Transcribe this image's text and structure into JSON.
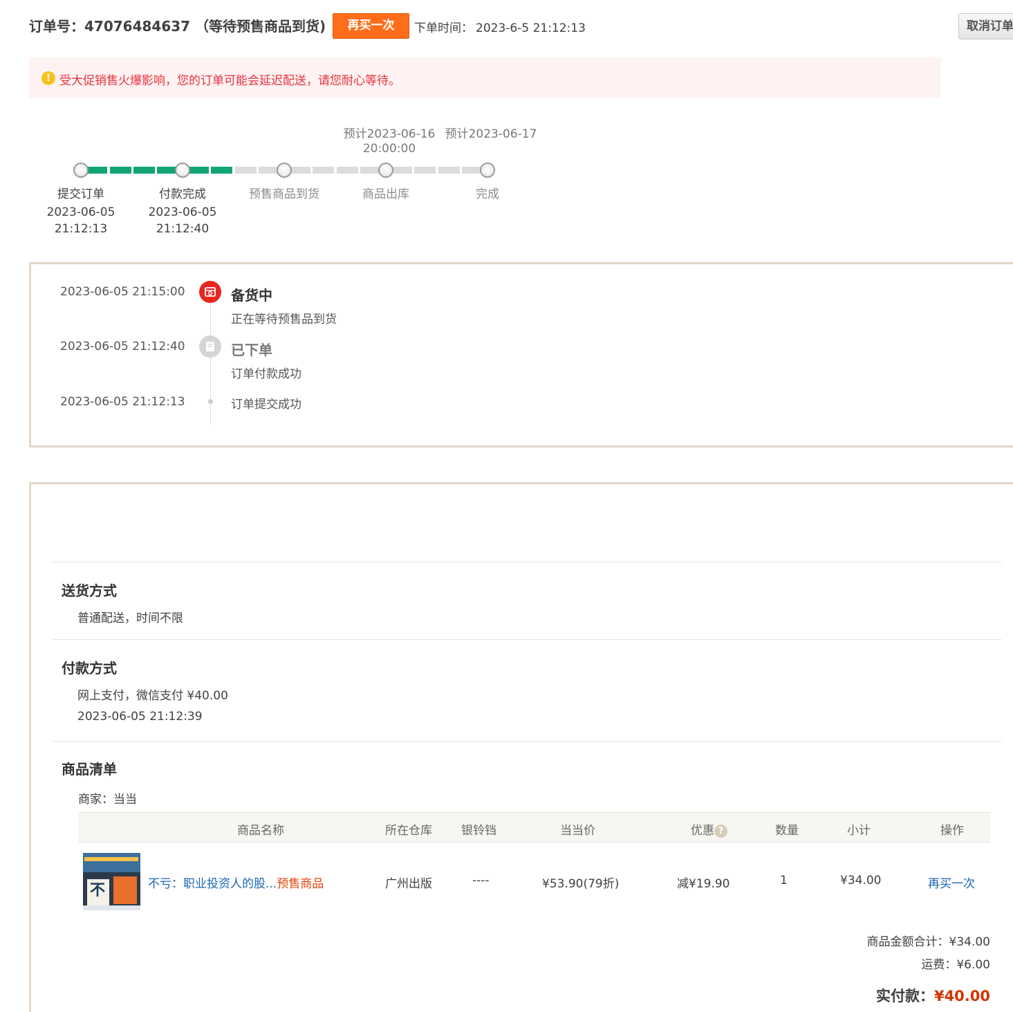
{
  "header": {
    "order_title": "订单号：47076484637 （等待预售商品到货)",
    "rebuy_label": "再买一次",
    "order_time_label": "下单时间：",
    "order_time_value": "2023-6-5 21:12:13",
    "cancel_label": "取消订单"
  },
  "notice": {
    "icon": "!",
    "text": "受大促销售火爆影响，您的订单可能会延迟配送，请您耐心等待。"
  },
  "progress": {
    "estimates": [
      {
        "line1": "预计2023-06-16",
        "line2": "20:00:00"
      },
      {
        "line1": "预计2023-06-17",
        "line2": ""
      }
    ],
    "steps": [
      {
        "label": "提交订单",
        "date": "2023-06-05",
        "time": "21:12:13",
        "done": true
      },
      {
        "label": "付款完成",
        "date": "2023-06-05",
        "time": "21:12:40",
        "done": true
      },
      {
        "label": "预售商品到货",
        "date": "",
        "time": "",
        "done": false
      },
      {
        "label": "商品出库",
        "date": "",
        "time": "",
        "done": false
      },
      {
        "label": "完成",
        "date": "",
        "time": "",
        "done": false
      }
    ],
    "done_color": "#12a471",
    "pending_color": "#dcdcdc"
  },
  "tracking": {
    "events": [
      {
        "time": "2023-06-05 21:15:00",
        "status": "备货中",
        "desc": "正在等待预售品到货",
        "icon": "warehouse-icon"
      },
      {
        "time": "2023-06-05 21:12:40",
        "status": "已下单",
        "desc": "订单付款成功",
        "icon": "document-icon"
      },
      {
        "time": "2023-06-05 21:12:13",
        "status": "",
        "desc": "订单提交成功",
        "icon": "dot-icon"
      }
    ]
  },
  "delivery": {
    "title": "送货方式",
    "text": "普通配送，时间不限"
  },
  "payment": {
    "title": "付款方式",
    "text": "网上支付，微信支付 ¥40.00",
    "time": "2023-06-05 21:12:39"
  },
  "goods": {
    "title": "商品清单",
    "merchant": "商家：当当",
    "headers": {
      "name": "商品名称",
      "warehouse": "所在仓库",
      "silver_bell": "银铃铛",
      "price": "当当价",
      "discount": "优惠",
      "qty": "数量",
      "subtotal": "小计",
      "action": "操作"
    },
    "help_icon": "?",
    "items": [
      {
        "name": "不亏：职业投资人的股...",
        "tag": "预售商品",
        "warehouse": "广州出版",
        "silver_bell": "----",
        "price": "¥53.90(79折)",
        "discount": "减¥19.90",
        "qty": "1",
        "subtotal": "¥34.00",
        "action": "再买一次"
      }
    ]
  },
  "summary": {
    "goods_total": "商品金额合计：¥34.00",
    "shipping": "运费：¥6.00",
    "paid_label": "实付款：",
    "paid_value": "¥40.00"
  },
  "colors": {
    "accent_orange": "#ff6d1a",
    "notice_red": "#e8323c",
    "link_blue": "#1a66b3",
    "paid_red": "#d23600"
  }
}
